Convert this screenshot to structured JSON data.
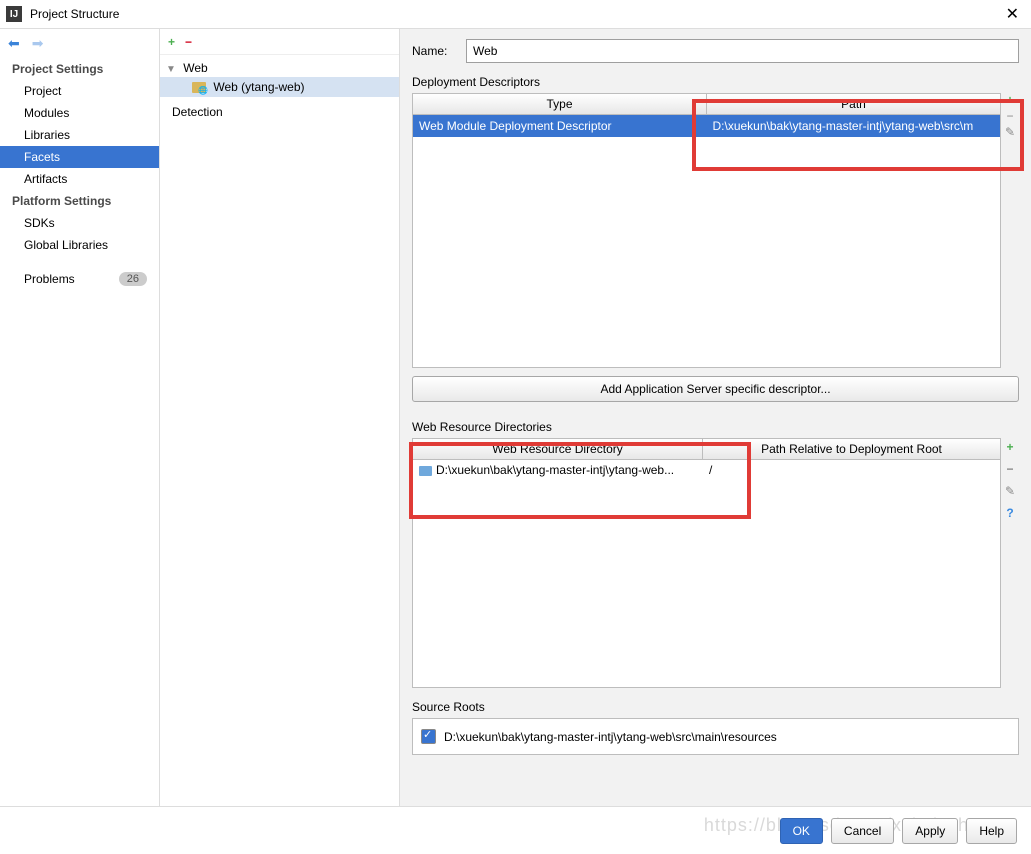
{
  "window": {
    "title": "Project Structure"
  },
  "nav": {
    "projectSettingsTitle": "Project Settings",
    "items": [
      "Project",
      "Modules",
      "Libraries",
      "Facets",
      "Artifacts"
    ],
    "platformTitle": "Platform Settings",
    "platformItems": [
      "SDKs",
      "Global Libraries"
    ],
    "problems": "Problems",
    "problemsCount": "26"
  },
  "tree": {
    "root": "Web",
    "child": "Web (ytang-web)",
    "detection": "Detection"
  },
  "form": {
    "nameLabel": "Name:",
    "nameValue": "Web",
    "ddLabel": "Deployment Descriptors",
    "ddHead": [
      "Type",
      "Path"
    ],
    "ddRow": [
      "Web Module Deployment Descriptor",
      "D:\\xuekun\\bak\\ytang-master-intj\\ytang-web\\src\\m"
    ],
    "addDesc": "Add Application Server specific descriptor...",
    "wrdLabel": "Web Resource Directories",
    "wrdHead": [
      "Web Resource Directory",
      "Path Relative to Deployment Root"
    ],
    "wrdRow": [
      "D:\\xuekun\\bak\\ytang-master-intj\\ytang-web...",
      "/"
    ],
    "srLabel": "Source Roots",
    "srPath": "D:\\xuekun\\bak\\ytang-master-intj\\ytang-web\\src\\main\\resources"
  },
  "footer": {
    "ok": "OK",
    "cancel": "Cancel",
    "apply": "Apply",
    "help": "Help"
  },
  "watermark": "https://blog.csdn.net/xxkalychen"
}
